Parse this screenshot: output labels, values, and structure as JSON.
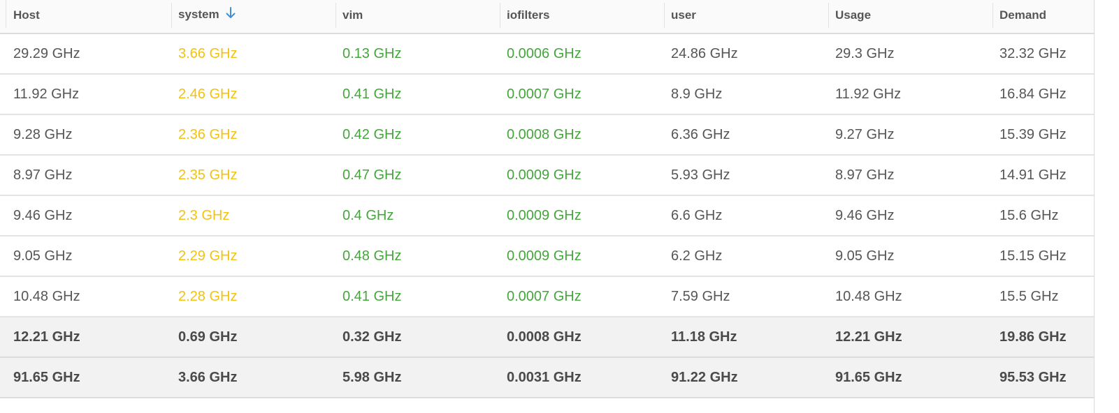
{
  "columns": [
    {
      "label": "Host"
    },
    {
      "label": "system",
      "sort": "descending"
    },
    {
      "label": "vim"
    },
    {
      "label": "iofilters"
    },
    {
      "label": "user"
    },
    {
      "label": "Usage"
    },
    {
      "label": "Demand"
    }
  ],
  "colors": {
    "system_value": "#f2c210",
    "vim_value": "#43a63a",
    "iofilters_value": "#43a63a",
    "sort_arrow": "#3d8fd9"
  },
  "rows": [
    [
      "29.29 GHz",
      "3.66 GHz",
      "0.13 GHz",
      "0.0006 GHz",
      "24.86 GHz",
      "29.3 GHz",
      "32.32 GHz"
    ],
    [
      "11.92 GHz",
      "2.46 GHz",
      "0.41 GHz",
      "0.0007 GHz",
      "8.9 GHz",
      "11.92 GHz",
      "16.84 GHz"
    ],
    [
      "9.28 GHz",
      "2.36 GHz",
      "0.42 GHz",
      "0.0008 GHz",
      "6.36 GHz",
      "9.27 GHz",
      "15.39 GHz"
    ],
    [
      "8.97 GHz",
      "2.35 GHz",
      "0.47 GHz",
      "0.0009 GHz",
      "5.93 GHz",
      "8.97 GHz",
      "14.91 GHz"
    ],
    [
      "9.46 GHz",
      "2.3 GHz",
      "0.4 GHz",
      "0.0009 GHz",
      "6.6 GHz",
      "9.46 GHz",
      "15.6 GHz"
    ],
    [
      "9.05 GHz",
      "2.29 GHz",
      "0.48 GHz",
      "0.0009 GHz",
      "6.2 GHz",
      "9.05 GHz",
      "15.15 GHz"
    ],
    [
      "10.48 GHz",
      "2.28 GHz",
      "0.41 GHz",
      "0.0007 GHz",
      "7.59 GHz",
      "10.48 GHz",
      "15.5 GHz"
    ]
  ],
  "summary_rows": [
    [
      "12.21 GHz",
      "0.69 GHz",
      "0.32 GHz",
      "0.0008 GHz",
      "11.18 GHz",
      "12.21 GHz",
      "19.86 GHz"
    ],
    [
      "91.65 GHz",
      "3.66 GHz",
      "5.98 GHz",
      "0.0031 GHz",
      "91.22 GHz",
      "91.65 GHz",
      "95.53 GHz"
    ]
  ]
}
